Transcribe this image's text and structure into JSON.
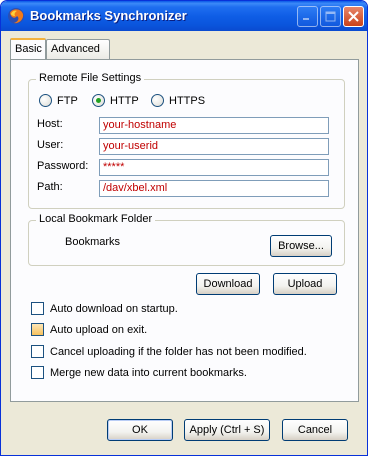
{
  "window": {
    "title": "Bookmarks Synchronizer"
  },
  "tabs": [
    {
      "label": "Basic",
      "active": true
    },
    {
      "label": "Advanced",
      "active": false
    }
  ],
  "remote": {
    "group_label": "Remote File Settings",
    "protocols": [
      {
        "label": "FTP",
        "selected": false
      },
      {
        "label": "HTTP",
        "selected": true
      },
      {
        "label": "HTTPS",
        "selected": false
      }
    ],
    "fields": {
      "host": {
        "label": "Host:",
        "value": "your-hostname"
      },
      "user": {
        "label": "User:",
        "value": "your-userid"
      },
      "password": {
        "label": "Password:",
        "value": "*****"
      },
      "path": {
        "label": "Path:",
        "value": "/dav/xbel.xml"
      }
    }
  },
  "local": {
    "group_label": "Local Bookmark Folder",
    "folder_name": "Bookmarks",
    "browse_label": "Browse..."
  },
  "actions": {
    "download_label": "Download",
    "upload_label": "Upload"
  },
  "options": [
    {
      "label": "Auto download on startup.",
      "checked": false
    },
    {
      "label": "Auto upload on exit.",
      "checked": false
    },
    {
      "label": "Cancel uploading if the folder has not been modified.",
      "checked": false
    },
    {
      "label": "Merge new data into current bookmarks.",
      "checked": false
    }
  ],
  "footer": {
    "ok_label": "OK",
    "apply_label": "Apply (Ctrl + S)",
    "cancel_label": "Cancel"
  },
  "colors": {
    "titlebar": "#0a55dc",
    "input_text": "#c00000",
    "radio_selected": "#21a121",
    "tab_accent": "#f3b23d"
  },
  "icons": {
    "app": "firefox-icon",
    "minimize": "minimize-icon",
    "maximize": "maximize-icon",
    "close": "close-icon"
  }
}
